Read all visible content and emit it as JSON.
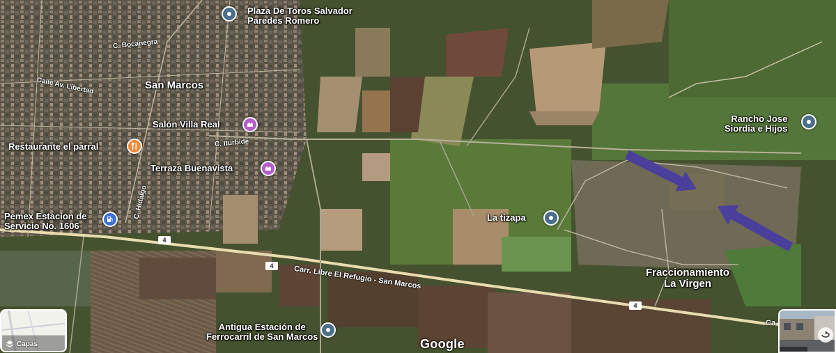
{
  "map": {
    "type": "satellite",
    "places": [
      {
        "id": "plaza-toros",
        "line1": "Plaza De Toros Salvador",
        "line2": "Paredes Romero",
        "icon": "landmark-pin-icon",
        "color": "#4d6f8b"
      },
      {
        "id": "san-marcos",
        "line1": "San Marcos"
      },
      {
        "id": "salon-villa-real",
        "line1": "Salón Villa Real",
        "icon": "event-venue-icon",
        "color": "#b45fc6"
      },
      {
        "id": "restaurante",
        "line1": "Restaurante el parral",
        "icon": "restaurant-icon",
        "color": "#f08b3a"
      },
      {
        "id": "terraza",
        "line1": "Terraza Buenavista",
        "icon": "event-venue-icon",
        "color": "#b45fc6"
      },
      {
        "id": "pemex",
        "line1": "Pemex Estacion de",
        "line2": "Servicio No. 1606",
        "icon": "gas-station-icon",
        "color": "#3f6fd8"
      },
      {
        "id": "rancho",
        "line1": "Rancho Jose",
        "line2": "Siordia e Hijos",
        "icon": "landmark-pin-icon",
        "color": "#4d6f8b"
      },
      {
        "id": "tizapa",
        "line1": "La tizapa",
        "icon": "landmark-pin-icon",
        "color": "#4d6f8b"
      },
      {
        "id": "fraccionamiento",
        "line1": "Fraccionamiento",
        "line2": "La Virgen"
      },
      {
        "id": "antigua",
        "line1": "Antigua Estación de",
        "line2": "Ferrocarril de San Marcos",
        "icon": "landmark-pin-icon",
        "color": "#4d6f8b"
      }
    ],
    "streets": {
      "bocanegra": "C. Bocanegra",
      "libertad": "Calle Av. Libertad",
      "iturbide": "C. Iturbide",
      "hidalgo": "C. Hidalgo",
      "carretera": "Carr. Libre El Refugio - San Marcos",
      "carretera_cut": "Ca"
    },
    "route_shields": [
      "4",
      "4",
      "4"
    ],
    "annotation_arrow_color": "#4b3f9c"
  },
  "controls": {
    "layers_label": "Capas",
    "google_logo": "Google"
  }
}
